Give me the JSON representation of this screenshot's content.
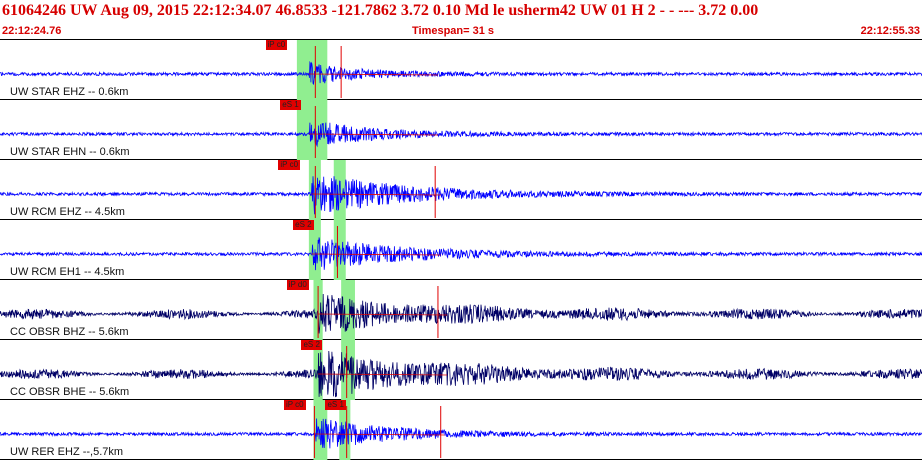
{
  "header": {
    "title_line": "61064246 UW Aug 09, 2015 22:12:34.07    46.8533 -121.7862  3.72 0.10 Md le     usherm42 UW 01 H     2   -   - ---   3.72 0.00",
    "start_time": "22:12:24.76",
    "timespan": "Timespan=  31 s",
    "end_time": "22:12:55.33"
  },
  "colors": {
    "header_text": "#d60000",
    "trace_blue": "#0000ff",
    "trace_navy": "#000066",
    "pick_red": "#e00000",
    "window_green": "#90ee90"
  },
  "traces": [
    {
      "label": "UW STAR EHZ -- 0.6km",
      "color": "#0000ff",
      "picks": [
        {
          "text": "iP c0",
          "pos": 0.314
        }
      ],
      "green": [
        [
          0.322,
          0.355
        ]
      ],
      "marks": [
        0.342,
        0.37
      ],
      "amp": 0.35,
      "onset": 0.335,
      "decay": 0.06
    },
    {
      "label": "UW STAR EHN -- 0.6km",
      "color": "#0000ff",
      "picks": [
        {
          "text": "eS 1",
          "pos": 0.33
        }
      ],
      "green": [
        [
          0.322,
          0.355
        ]
      ],
      "marks": [
        0.342
      ],
      "amp": 0.45,
      "onset": 0.335,
      "decay": 0.07
    },
    {
      "label": "UW RCM EHZ -- 4.5km",
      "color": "#0000ff",
      "picks": [
        {
          "text": "iP c0",
          "pos": 0.328
        }
      ],
      "green": [
        [
          0.335,
          0.348
        ],
        [
          0.362,
          0.375
        ]
      ],
      "marks": [
        0.342,
        0.472
      ],
      "amp": 0.7,
      "onset": 0.338,
      "decay": 0.1
    },
    {
      "label": "UW RCM EH1 -- 4.5km",
      "color": "#0000ff",
      "picks": [
        {
          "text": "eS 2",
          "pos": 0.344
        }
      ],
      "green": [
        [
          0.335,
          0.348
        ],
        [
          0.362,
          0.375
        ]
      ],
      "marks": [
        0.366
      ],
      "amp": 0.55,
      "onset": 0.338,
      "decay": 0.1
    },
    {
      "label": "CC OBSR BHZ -- 5.6km",
      "color": "#000066",
      "picks": [
        {
          "text": "iP d0",
          "pos": 0.337
        }
      ],
      "green": [
        [
          0.34,
          0.35
        ],
        [
          0.37,
          0.385
        ]
      ],
      "marks": [
        0.345,
        0.475
      ],
      "amp": 0.55,
      "onset": 0.345,
      "decay": 0.14
    },
    {
      "label": "CC OBSR BHE -- 5.6km",
      "color": "#000066",
      "picks": [
        {
          "text": "eS 2",
          "pos": 0.353
        }
      ],
      "green": [
        [
          0.34,
          0.35
        ],
        [
          0.37,
          0.385
        ]
      ],
      "marks": [
        0.376
      ],
      "amp": 0.7,
      "onset": 0.345,
      "decay": 0.14
    },
    {
      "label": "UW RER EHZ --,5.7km",
      "color": "#0000ff",
      "picks": [
        {
          "text": "iP c0",
          "pos": 0.334
        },
        {
          "text": "eS 1",
          "pos": 0.379
        }
      ],
      "green": [
        [
          0.34,
          0.355
        ],
        [
          0.368,
          0.38
        ]
      ],
      "marks": [
        0.341,
        0.376,
        0.478
      ],
      "amp": 0.55,
      "onset": 0.342,
      "decay": 0.08
    }
  ]
}
